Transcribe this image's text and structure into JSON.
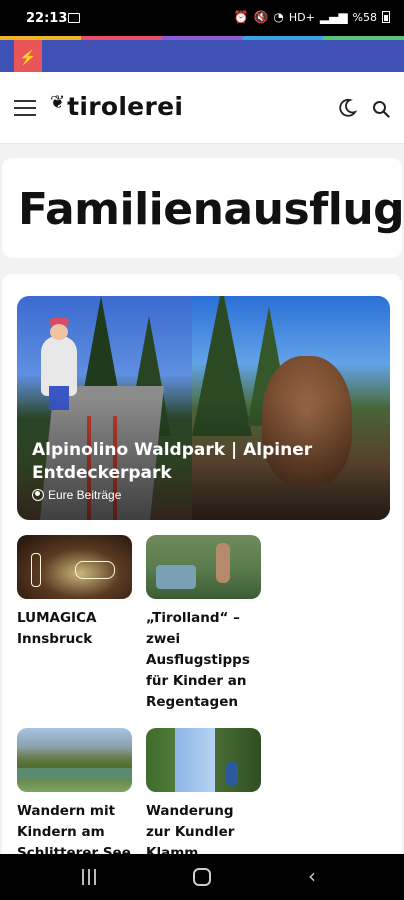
{
  "status_bar": {
    "time": "22:13",
    "network": "HD+",
    "battery": "%58"
  },
  "header": {
    "logo_text": "tirolerei",
    "menu_icon": "hamburger-menu-icon",
    "theme_icon": "moon-icon",
    "search_icon": "search-icon"
  },
  "page": {
    "title": "Familienausflug"
  },
  "featured": {
    "title": "Alpinolino Waldpark | Alpiner Entdeckerpark",
    "author": "Eure Beiträge"
  },
  "posts": [
    {
      "title": "LUMAGICA Innsbruck"
    },
    {
      "title": "„Tirolland“ – zwei Ausflugstipps für Kinder an Regentagen"
    },
    {
      "title": "Wandern mit Kindern am Schlitterer See"
    },
    {
      "title": "Wanderung zur Kundler Klamm"
    }
  ],
  "colors": {
    "ad_bar": "#3f51b5",
    "flash_badge": "#e8565a",
    "page_bg": "#f2f2f2"
  }
}
